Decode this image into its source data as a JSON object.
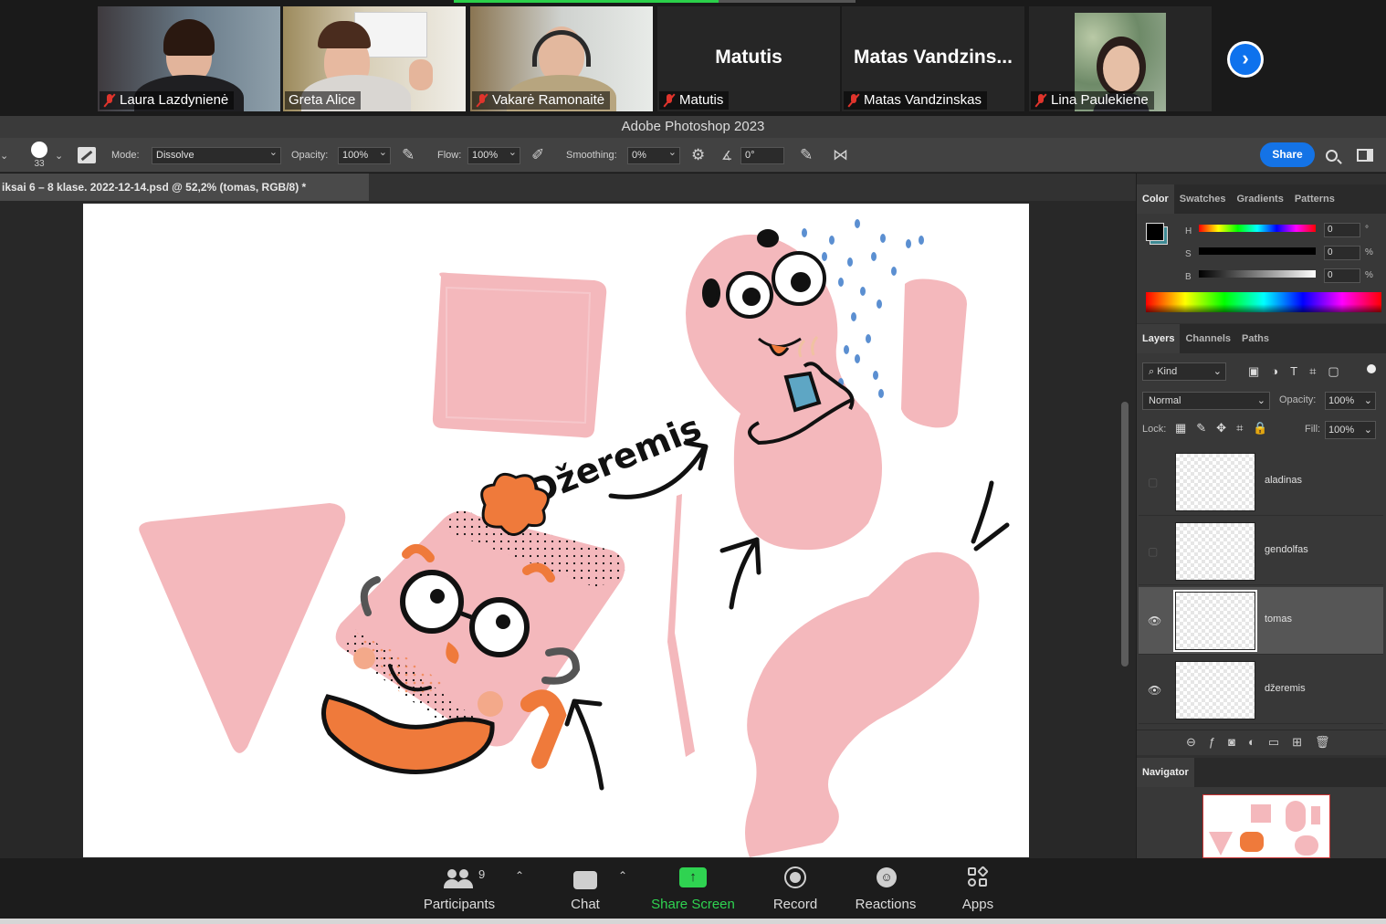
{
  "gallery": {
    "participants": [
      {
        "name": "Laura Lazdynienė",
        "muted": true,
        "video": true
      },
      {
        "name": "Greta Alice",
        "muted": false,
        "video": true,
        "active": true
      },
      {
        "name": "Vakarė Ramonaitė",
        "muted": true,
        "video": true
      },
      {
        "name": "Matutis",
        "muted": true,
        "video": false
      },
      {
        "name": "Matas Vandzinskas",
        "display_name": "Matas  Vandzins...",
        "muted": true,
        "video": false
      },
      {
        "name": "Lina Paulekiene",
        "muted": true,
        "video": true
      }
    ],
    "next_icon": "chevron-right-icon"
  },
  "photoshop": {
    "app_title": "Adobe Photoshop 2023",
    "options_bar": {
      "brush_size": "33",
      "mode_label": "Mode:",
      "mode_value": "Dissolve",
      "opacity_label": "Opacity:",
      "opacity_value": "100%",
      "flow_label": "Flow:",
      "flow_value": "100%",
      "smoothing_label": "Smoothing:",
      "smoothing_value": "0%",
      "angle_value": "0°",
      "share_label": "Share"
    },
    "document_tab": "iksai 6 – 8 klase. 2022-12-14.psd @ 52,2% (tomas, RGB/8) *",
    "canvas": {
      "handwritten_label": "Džeremis",
      "colors": {
        "pink": "#f4b8bc",
        "orange": "#ef7a3b",
        "blue": "#5b8fd1",
        "black": "#111111"
      }
    },
    "color_panel": {
      "tabs": [
        "Color",
        "Swatches",
        "Gradients",
        "Patterns"
      ],
      "active_tab": "Color",
      "sliders": [
        {
          "label": "H",
          "value": "0",
          "unit": "°"
        },
        {
          "label": "S",
          "value": "0",
          "unit": "%"
        },
        {
          "label": "B",
          "value": "0",
          "unit": "%"
        }
      ],
      "foreground": "#000000",
      "background": "#3e8a94"
    },
    "layers_panel": {
      "tabs": [
        "Layers",
        "Channels",
        "Paths"
      ],
      "active_tab": "Layers",
      "filter_label": "Kind",
      "blend_mode": "Normal",
      "opacity_label": "Opacity:",
      "opacity_value": "100%",
      "lock_label": "Lock:",
      "fill_label": "Fill:",
      "fill_value": "100%",
      "layers": [
        {
          "name": "aladinas",
          "visible": false,
          "selected": false
        },
        {
          "name": "gendolfas",
          "visible": false,
          "selected": false
        },
        {
          "name": "tomas",
          "visible": true,
          "selected": true
        },
        {
          "name": "džeremis",
          "visible": true,
          "selected": false
        }
      ]
    },
    "navigator": {
      "title": "Navigator"
    }
  },
  "zoom_toolbar": {
    "participants_label": "Participants",
    "participants_count": "9",
    "chat_label": "Chat",
    "share_label": "Share Screen",
    "record_label": "Record",
    "reactions_label": "Reactions",
    "apps_label": "Apps",
    "share_color": "#2fd351"
  }
}
